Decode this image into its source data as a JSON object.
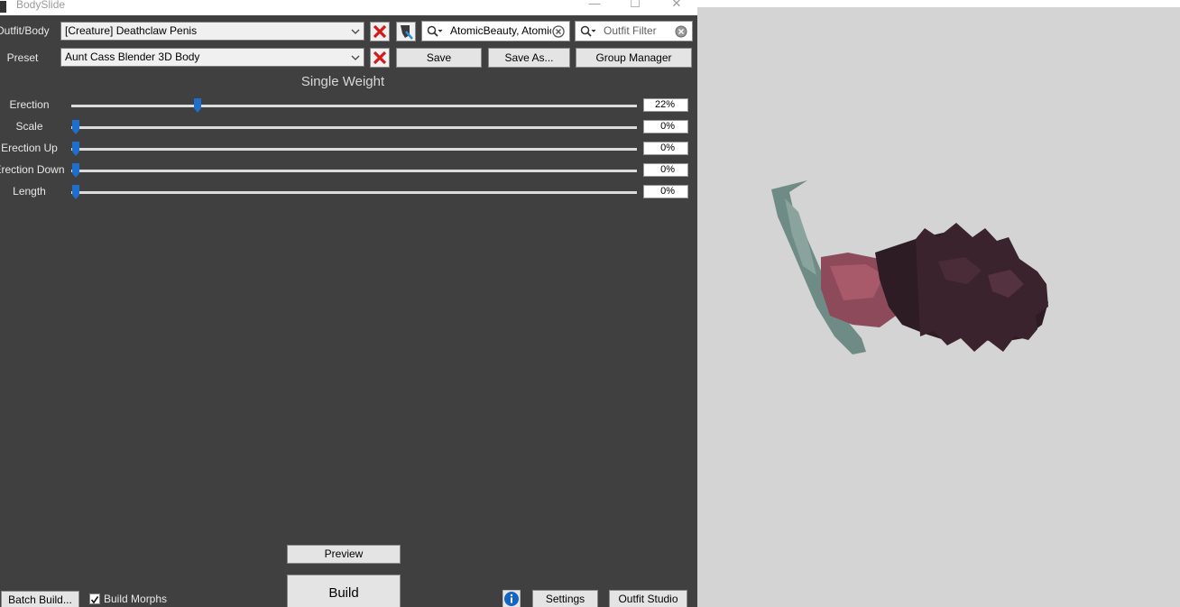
{
  "window": {
    "title": "BodySlide",
    "minimize_glyph": "—",
    "maximize_glyph": "☐",
    "close_glyph": "✕"
  },
  "outfit": {
    "label": "Outfit/Body",
    "selected": "[Creature] Deathclaw Penis"
  },
  "preset": {
    "label": "Preset",
    "selected": "Aunt Cass Blender 3D Body"
  },
  "buttons": {
    "save": "Save",
    "save_as": "Save As...",
    "group_manager": "Group Manager",
    "preview": "Preview",
    "build": "Build",
    "batch_build": "Batch Build...",
    "settings": "Settings",
    "outfit_studio": "Outfit Studio"
  },
  "search": {
    "group_filter_value": "AtomicBeauty, Atomic",
    "outfit_filter_placeholder": "Outfit Filter"
  },
  "section_title": "Single Weight",
  "sliders": [
    {
      "label": "Erection",
      "value_text": "22%",
      "value": 22
    },
    {
      "label": "Scale",
      "value_text": "0%",
      "value": 0
    },
    {
      "label": "Erection Up",
      "value_text": "0%",
      "value": 0
    },
    {
      "label": "Erection Down",
      "value_text": "0%",
      "value": 0
    },
    {
      "label": "Length",
      "value_text": "0%",
      "value": 0
    }
  ],
  "build_morphs": {
    "label": "Build Morphs",
    "checked": true
  },
  "colors": {
    "panel_bg": "#404040",
    "viewport_bg": "#d4d4d4",
    "slider_thumb": "#1e6ecc",
    "remove_x": "#d61818",
    "info": "#1565c0"
  },
  "icons": {
    "remove": "red-x-icon",
    "filter_tool": "brush-filter-icon",
    "search": "search-icon",
    "clear": "clear-circle-icon",
    "info": "info-icon",
    "dropdown": "chevron-down-icon"
  }
}
